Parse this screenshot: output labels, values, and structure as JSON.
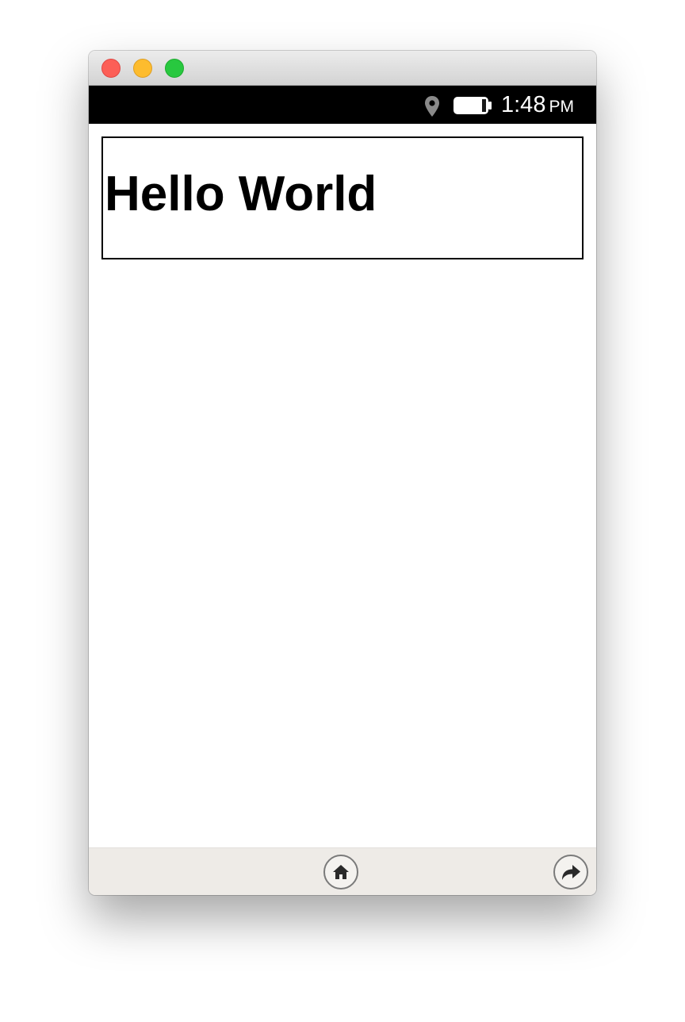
{
  "window": {
    "traffic_lights": [
      "close",
      "minimize",
      "zoom"
    ]
  },
  "status_bar": {
    "icons": [
      "location-icon",
      "battery-icon"
    ],
    "time": "1:48",
    "ampm": "PM"
  },
  "content": {
    "heading": "Hello World"
  },
  "bottom_bar": {
    "buttons": [
      "home-icon",
      "forward-icon"
    ]
  },
  "colors": {
    "close": "#fc5f57",
    "minimize": "#fdbc2e",
    "zoom": "#28c83f",
    "status_bar": "#000000",
    "bottom_bar": "#eeebe7"
  }
}
